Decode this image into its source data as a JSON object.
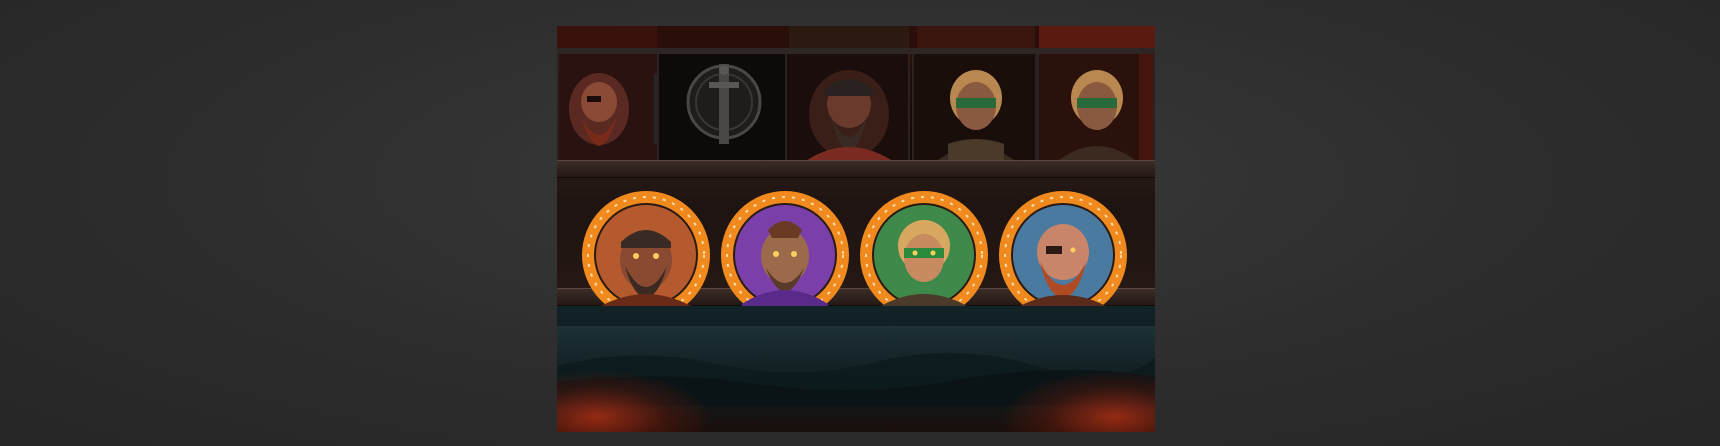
{
  "game": {
    "reel_symbols": [
      {
        "name": "eyepatch-warrior-symbol",
        "color": "#8a3a2a"
      },
      {
        "name": "sword-shield-symbol",
        "color": "#3a3a3a"
      },
      {
        "name": "bandana-warrior-symbol",
        "color": "#5a2a22"
      },
      {
        "name": "shieldmaiden-symbol",
        "color": "#6a3a28"
      },
      {
        "name": "shieldmaiden-symbol",
        "color": "#6a3a28"
      }
    ],
    "portraits": [
      {
        "name": "bandana-warrior-portrait",
        "bg": "#b45a2e",
        "accent": "#e07b2d"
      },
      {
        "name": "mohawk-warrior-portrait",
        "bg": "#7a3fa8",
        "accent": "#e07b2d"
      },
      {
        "name": "shieldmaiden-portrait",
        "bg": "#3f8a4a",
        "accent": "#e07b2d"
      },
      {
        "name": "eyepatch-warrior-portrait",
        "bg": "#4a7aa0",
        "accent": "#e07b2d"
      }
    ],
    "colors": {
      "ring_orange": "#f08a1e",
      "ring_dark": "#3a2418",
      "rune_color": "#fff2d0"
    }
  }
}
